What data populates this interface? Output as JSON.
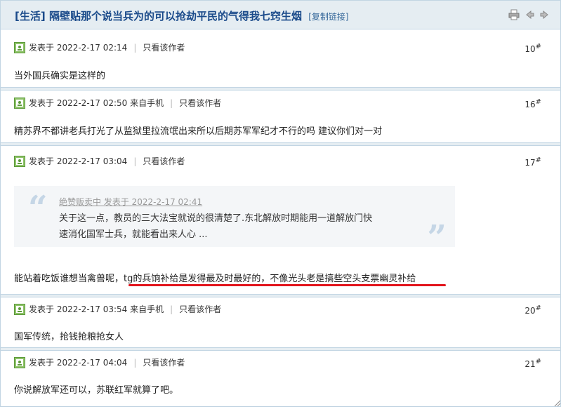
{
  "thread": {
    "category": "[生活]",
    "title": "隔壁贴那个说当兵为的可以抢劫平民的气得我七窍生烟",
    "copy_link": "[复制链接]",
    "icons": [
      "print-icon",
      "prev-icon",
      "next-icon"
    ]
  },
  "posts": [
    {
      "posted_at": "发表于 2022-2-17 02:14",
      "only_author": "只看该作者",
      "floor": "10",
      "floor_mark": "#",
      "content": "当外国兵确实是这样的"
    },
    {
      "posted_at": "发表于 2022-2-17 02:50 来自手机",
      "only_author": "只看该作者",
      "floor": "16",
      "floor_mark": "#",
      "content": "精苏界不都讲老兵打光了从监狱里拉流氓出来所以后期苏军军纪才不行的吗 建议你们对一对"
    },
    {
      "posted_at": "发表于 2022-2-17 03:04",
      "only_author": "只看该作者",
      "floor": "17",
      "floor_mark": "#",
      "quote": {
        "head": "绝赞贩卖中 发表于 2022-2-17 02:41",
        "line1": "关于这一点，教员的三大法宝就说的很清楚了.东北解放时期能用一道解放门快",
        "line2": "速消化国军士兵，就能看出来人心 ..."
      },
      "content": "能站着吃饭谁想当禽兽呢，tg的兵饷补给是发得最及时最好的，不像光头老是搞些空头支票幽灵补给"
    },
    {
      "posted_at": "发表于 2022-2-17 03:54 来自手机",
      "only_author": "只看该作者",
      "floor": "20",
      "floor_mark": "#",
      "content": "国军传统，抢钱抢粮抢女人"
    },
    {
      "posted_at": "发表于 2022-2-17 04:04",
      "only_author": "只看该作者",
      "floor": "21",
      "floor_mark": "#",
      "content": "你说解放军还可以，苏联红军就算了吧。"
    }
  ],
  "pipe": "|",
  "quote_open": "“",
  "quote_close": "”"
}
